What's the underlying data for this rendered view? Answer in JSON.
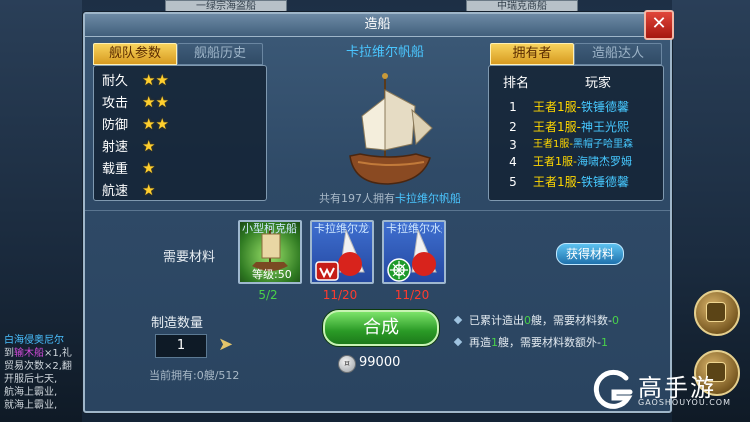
{
  "background": {
    "top_tabs": [
      "一绿宗海盗船",
      "中瑞克商船"
    ],
    "chat_lines": [
      "白海侵奥尼尔",
      "到",
      "输木船",
      "×1,礼",
      "贸易次数×2,翻",
      "开服后七天,",
      "航海上霸业,",
      "就海上霸业,"
    ]
  },
  "dialog": {
    "title": "造船",
    "close_glyph": "✕",
    "left_tabs": [
      {
        "label": "舰队参数",
        "active": true
      },
      {
        "label": "舰船历史",
        "active": false
      }
    ],
    "right_tabs": [
      {
        "label": "拥有者",
        "active": true
      },
      {
        "label": "造船达人",
        "active": false
      }
    ],
    "stats": [
      {
        "label": "耐久",
        "stars": "★★"
      },
      {
        "label": "攻击",
        "stars": "★★"
      },
      {
        "label": "防御",
        "stars": "★★"
      },
      {
        "label": "射速",
        "stars": "★"
      },
      {
        "label": "载重",
        "stars": "★"
      },
      {
        "label": "航速",
        "stars": "★"
      }
    ],
    "ship": {
      "name": "卡拉维尔帆船",
      "owners_prefix": "共有197人拥有",
      "owners_ship": "卡拉维尔帆船"
    },
    "owners": {
      "col_rank": "排名",
      "col_player": "玩家",
      "rows": [
        {
          "rank": "1",
          "server": "王者1服",
          "sep": "-",
          "name": "铁锤德馨"
        },
        {
          "rank": "2",
          "server": "王者1服",
          "sep": "-",
          "name": "神王光熙"
        },
        {
          "rank": "3",
          "server": "王者1服",
          "sep": "-",
          "name": "黑帽子哈里森"
        },
        {
          "rank": "4",
          "server": "王者1服",
          "sep": "-",
          "name": "海啸杰罗姆"
        },
        {
          "rank": "5",
          "server": "王者1服",
          "sep": "-",
          "name": "铁锤德馨"
        }
      ]
    },
    "materials": {
      "label": "需要材料",
      "items": [
        {
          "caption": "小型柯克船",
          "level": "等级:50",
          "count": "5/2",
          "count_color": "#49d14a"
        },
        {
          "caption": "卡拉维尔龙骨",
          "level": "",
          "count": "11/20",
          "count_color": "#ff3b2f"
        },
        {
          "caption": "卡拉维尔水舵",
          "level": "",
          "count": "11/20",
          "count_color": "#ff3b2f"
        }
      ],
      "get_button": "获得材料"
    },
    "build": {
      "qty_label": "制造数量",
      "qty_value": "1",
      "current": "当前拥有:0艘/512",
      "build_button": "合成",
      "cost": "99000",
      "info_1_prefix": "已累计造出",
      "info_1_count": "0",
      "info_1_mid": "艘，需要材料数-",
      "info_1_extra": "0",
      "info_2_prefix": "再造",
      "info_2_count": "1",
      "info_2_mid": "艘，需要材料数额外-",
      "info_2_extra": "1"
    }
  },
  "watermark": {
    "brand": "高手游",
    "domain": "GAOSHOUYOU.COM"
  },
  "colors": {
    "accent_gold": "#f8d35c",
    "accent_blue": "#4ac6ff",
    "build_green": "#2a9a26",
    "close_red": "#c7271a"
  }
}
